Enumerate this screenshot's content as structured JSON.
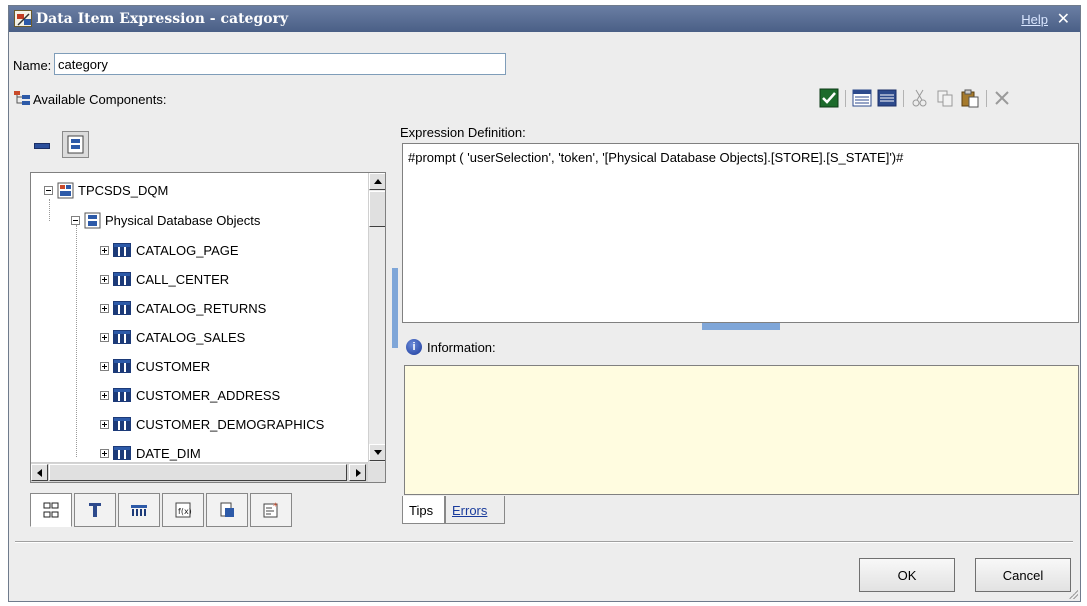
{
  "window": {
    "title": "Data Item Expression - category",
    "help_label": "Help",
    "close_label": "✕"
  },
  "name_field": {
    "label": "Name:",
    "value": "category"
  },
  "available_components": {
    "label": "Available Components:"
  },
  "toolbar": {
    "icons": [
      "validate-check-icon",
      "insert-item-icon",
      "insert-filter-icon",
      "cut-icon",
      "copy-icon",
      "paste-icon",
      "delete-icon"
    ]
  },
  "tree": {
    "root": {
      "label": "TPCSDS_DQM",
      "expanded": true
    },
    "folder": {
      "label": "Physical Database Objects",
      "expanded": true
    },
    "items": [
      "CATALOG_PAGE",
      "CALL_CENTER",
      "CATALOG_RETURNS",
      "CATALOG_SALES",
      "CUSTOMER",
      "CUSTOMER_ADDRESS",
      "CUSTOMER_DEMOGRAPHICS",
      "DATE_DIM"
    ]
  },
  "tree_tabs": [
    "source-tab-icon",
    "data-items-tab-icon",
    "query-items-tab-icon",
    "functions-tab-icon",
    "parameters-tab-icon",
    "macros-tab-icon"
  ],
  "expression": {
    "label": "Expression Definition:",
    "value": "#prompt ( 'userSelection', 'token', '[Physical Database Objects].[STORE].[S_STATE]')#"
  },
  "information": {
    "label": "Information:"
  },
  "bottom_tabs": {
    "tips": "Tips",
    "errors": "Errors"
  },
  "buttons": {
    "ok": "OK",
    "cancel": "Cancel"
  },
  "colors": {
    "titlebar": "#52678f",
    "info_bg": "#fffce0",
    "accent_blue": "#7fa6d8"
  }
}
